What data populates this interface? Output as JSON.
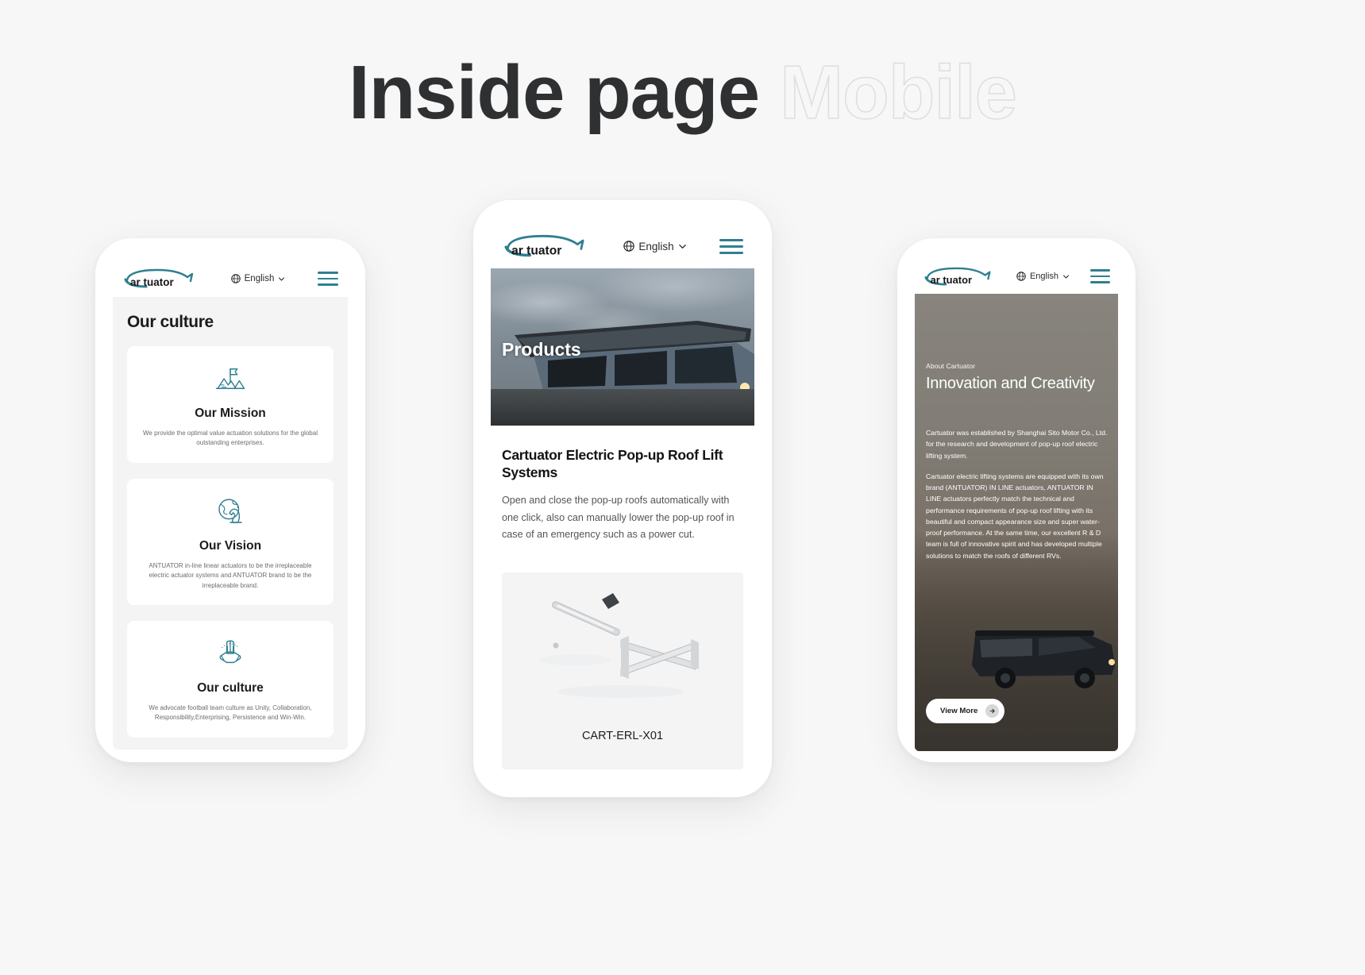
{
  "heading": {
    "solid": "Inside page",
    "outline": "Mobile"
  },
  "brand": {
    "logo_text": "cartuator",
    "accent_color": "#2f7f91",
    "logo_icon": "car-swoosh-icon"
  },
  "navbar": {
    "language_label": "English",
    "globe_icon": "globe-icon",
    "chevron_icon": "chevron-down-icon",
    "menu_icon": "hamburger-menu-icon"
  },
  "phone1": {
    "page_title": "Our culture",
    "cards": [
      {
        "icon": "mountain-flag-icon",
        "title": "Our Mission",
        "desc": "We provide the optimal value actuation solutions for the global outstanding  enterprises."
      },
      {
        "icon": "globe-chess-knight-icon",
        "title": "Our Vision",
        "desc": "ANTUATOR in-line linear actuators to be the irreplaceable electric actuator systems and ANTUATOR brand to be the irreplaceable brand."
      },
      {
        "icon": "teamwork-hands-icon",
        "title": "Our culture",
        "desc": "We advocate football team culture as Unity, Collaboration, Responsibility,Enterprising, Persistence and Win-Win."
      }
    ]
  },
  "phone2": {
    "hero_label": "Products",
    "hero_image": "pop-up-roof-truck-photo",
    "product_title": "Cartuator Electric Pop-up Roof Lift Systems",
    "product_desc": "Open and close the pop-up roofs automatically with one click, also can manually lower the pop-up roof in case of an emergency such as a power cut.",
    "product_card": {
      "image": "scissor-lift-actuator-photo",
      "sku": "CART-ERL-X01"
    }
  },
  "phone3": {
    "kicker": "About Cartuator",
    "title": "Innovation and Creativity",
    "paragraphs": [
      "Cartuator was established by Shanghai Sito Motor Co., Ltd. for the research and development of pop-up roof electric lifting system.",
      "Cartuator electric lifting systems are equipped with its own brand (ANTUATOR) IN LINE actuators, ANTUATOR IN LINE actuators perfectly match the technical and performance requirements of pop-up roof lifting with its beautiful and compact appearance size and super water-proof performance. At the same time, our excellent R & D team is full of innovative spirit and has developed multiple solutions to match the roofs of different RVs."
    ],
    "view_more_label": "View More",
    "view_more_icon": "arrow-right-icon",
    "background_image": "camper-van-landscape-photo"
  }
}
